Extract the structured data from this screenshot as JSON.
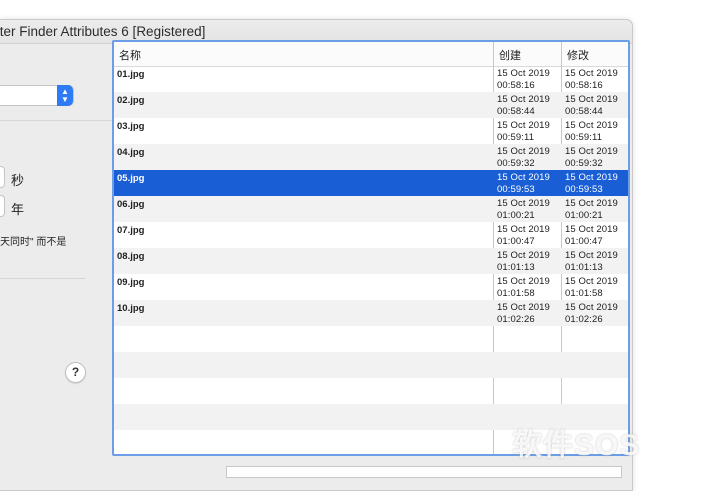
{
  "window": {
    "title": "tter Finder Attributes 6 [Registered]"
  },
  "left_panel": {
    "unit_seconds": "秒",
    "unit_year": "年",
    "note": "天同时\" 而不是",
    "help_label": "?"
  },
  "table": {
    "headers": {
      "name": "名称",
      "created": "创建",
      "modified": "修改"
    },
    "rows": [
      {
        "name": "01.jpg",
        "created_date": "15 Oct 2019",
        "created_time": "00:58:16",
        "modified_date": "15 Oct 2019",
        "modified_time": "00:58:16"
      },
      {
        "name": "02.jpg",
        "created_date": "15 Oct 2019",
        "created_time": "00:58:44",
        "modified_date": "15 Oct 2019",
        "modified_time": "00:58:44"
      },
      {
        "name": "03.jpg",
        "created_date": "15 Oct 2019",
        "created_time": "00:59:11",
        "modified_date": "15 Oct 2019",
        "modified_time": "00:59:11"
      },
      {
        "name": "04.jpg",
        "created_date": "15 Oct 2019",
        "created_time": "00:59:32",
        "modified_date": "15 Oct 2019",
        "modified_time": "00:59:32"
      },
      {
        "name": "05.jpg",
        "created_date": "15 Oct 2019",
        "created_time": "00:59:53",
        "modified_date": "15 Oct 2019",
        "modified_time": "00:59:53"
      },
      {
        "name": "06.jpg",
        "created_date": "15 Oct 2019",
        "created_time": "01:00:21",
        "modified_date": "15 Oct 2019",
        "modified_time": "01:00:21"
      },
      {
        "name": "07.jpg",
        "created_date": "15 Oct 2019",
        "created_time": "01:00:47",
        "modified_date": "15 Oct 2019",
        "modified_time": "01:00:47"
      },
      {
        "name": "08.jpg",
        "created_date": "15 Oct 2019",
        "created_time": "01:01:13",
        "modified_date": "15 Oct 2019",
        "modified_time": "01:01:13"
      },
      {
        "name": "09.jpg",
        "created_date": "15 Oct 2019",
        "created_time": "01:01:58",
        "modified_date": "15 Oct 2019",
        "modified_time": "01:01:58"
      },
      {
        "name": "10.jpg",
        "created_date": "15 Oct 2019",
        "created_time": "01:02:26",
        "modified_date": "15 Oct 2019",
        "modified_time": "01:02:26"
      }
    ],
    "selected_row": "05.jpg"
  },
  "watermark": "软件SOS",
  "colors": {
    "selection": "#1a5ed6",
    "focus_ring": "#6b9ee6",
    "popup_accent": "#2f7bf5"
  }
}
